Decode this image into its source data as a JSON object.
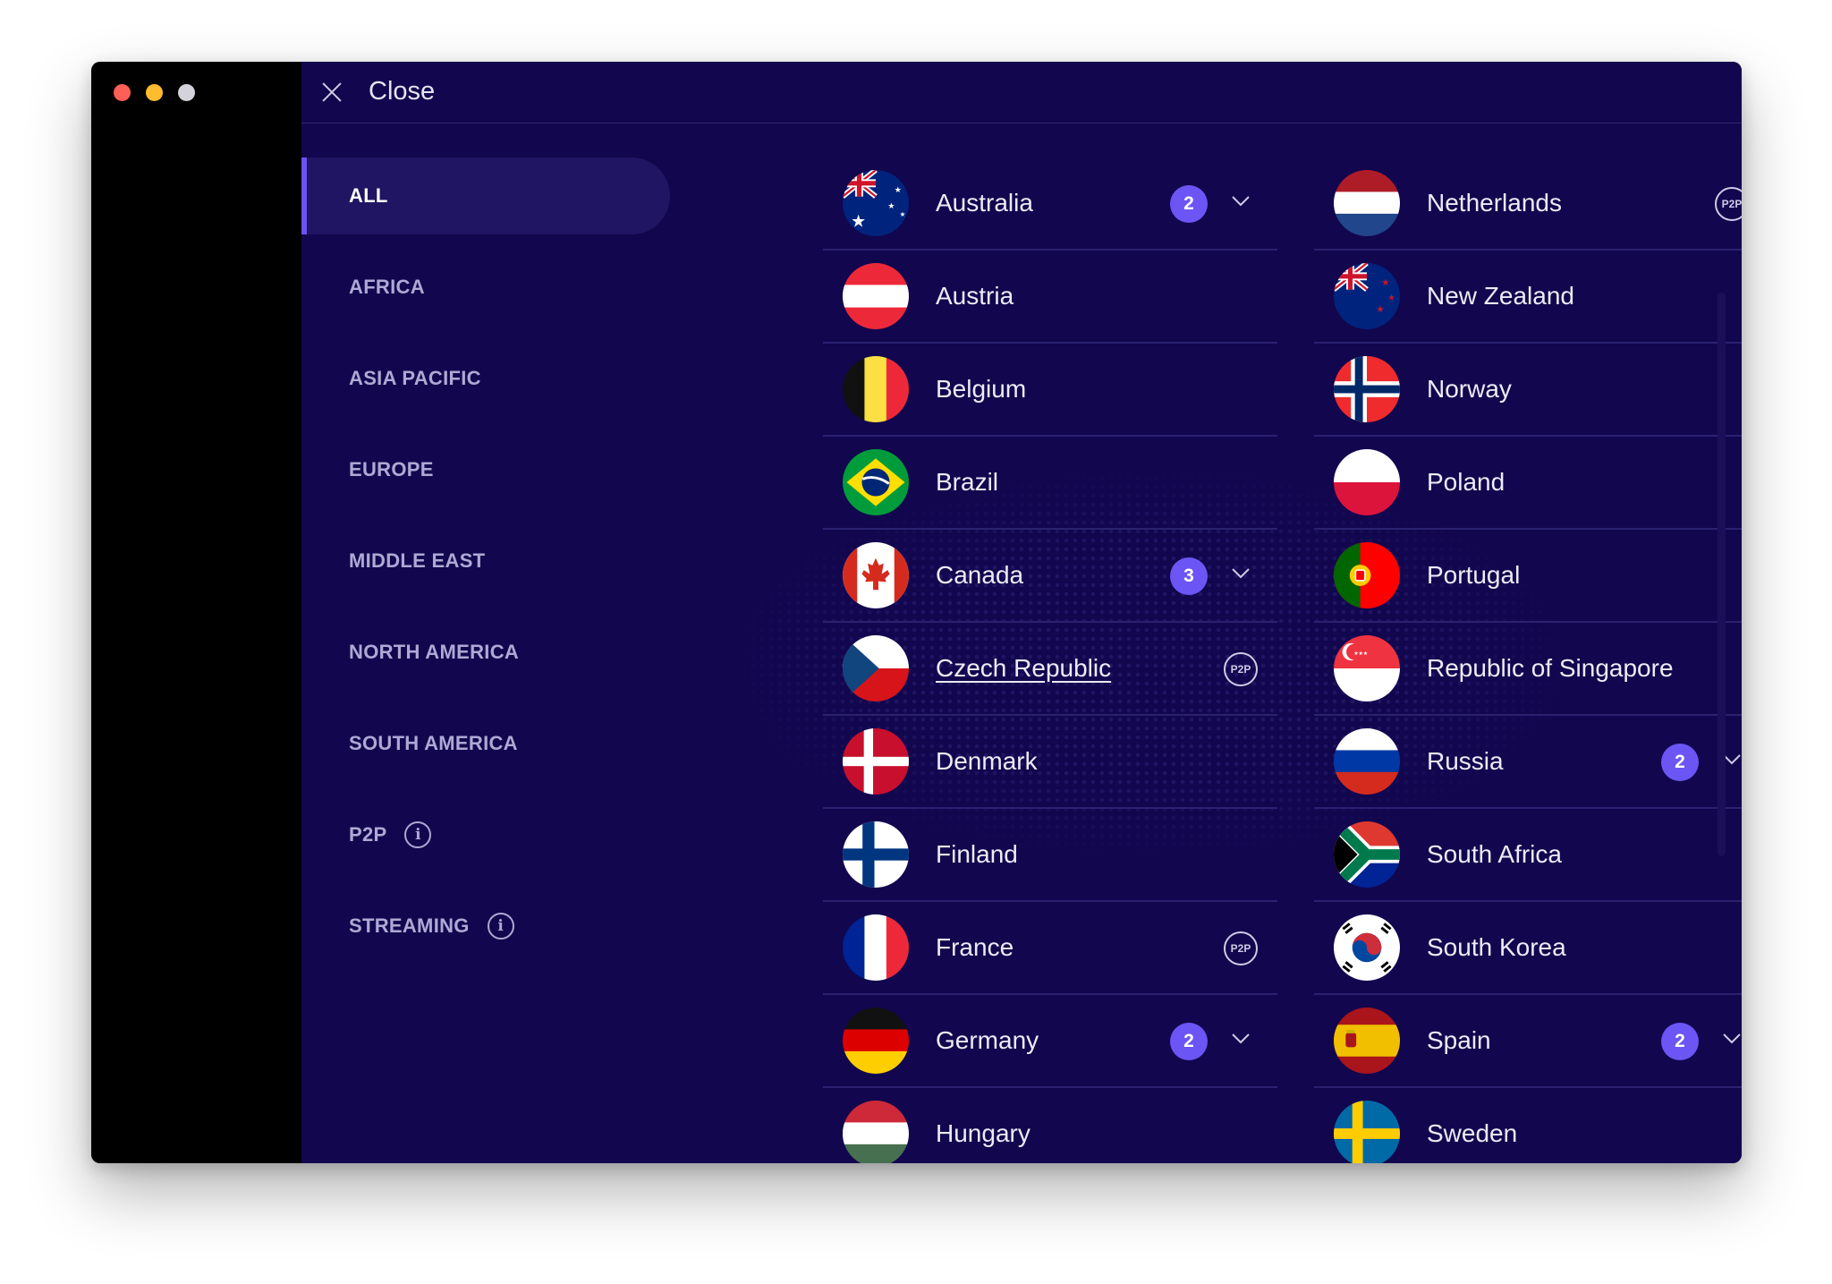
{
  "topbar": {
    "close_label": "Close"
  },
  "sidebar": {
    "categories": [
      {
        "label": "ALL",
        "active": true
      },
      {
        "label": "AFRICA"
      },
      {
        "label": "ASIA PACIFIC"
      },
      {
        "label": "EUROPE"
      },
      {
        "label": "MIDDLE EAST"
      },
      {
        "label": "NORTH AMERICA"
      },
      {
        "label": "SOUTH AMERICA"
      },
      {
        "label": "P2P",
        "info": true
      },
      {
        "label": "STREAMING",
        "info": true
      }
    ]
  },
  "countries": {
    "left": [
      {
        "name": "Australia",
        "count": "2",
        "flag": "australia-flag-icon"
      },
      {
        "name": "Austria",
        "flag": "austria-flag-icon"
      },
      {
        "name": "Belgium",
        "flag": "belgium-flag-icon"
      },
      {
        "name": "Brazil",
        "flag": "brazil-flag-icon"
      },
      {
        "name": "Canada",
        "count": "3",
        "flag": "canada-flag-icon"
      },
      {
        "name": "Czech Republic",
        "p2p": "P2P",
        "flag": "czech-flag-icon"
      },
      {
        "name": "Denmark",
        "flag": "denmark-flag-icon"
      },
      {
        "name": "Finland",
        "flag": "finland-flag-icon"
      },
      {
        "name": "France",
        "p2p": "P2P",
        "flag": "france-flag-icon"
      },
      {
        "name": "Germany",
        "count": "2",
        "flag": "germany-flag-icon"
      },
      {
        "name": "Hungary",
        "flag": "hungary-flag-icon"
      }
    ],
    "right": [
      {
        "name": "Netherlands",
        "p2p": "P2P",
        "flag": "netherlands-flag-icon"
      },
      {
        "name": "New Zealand",
        "flag": "new-zealand-flag-icon"
      },
      {
        "name": "Norway",
        "flag": "norway-flag-icon"
      },
      {
        "name": "Poland",
        "flag": "poland-flag-icon"
      },
      {
        "name": "Portugal",
        "flag": "portugal-flag-icon"
      },
      {
        "name": "Republic of Singapore",
        "flag": "singapore-flag-icon"
      },
      {
        "name": "Russia",
        "count": "2",
        "flag": "russia-flag-icon"
      },
      {
        "name": "South Africa",
        "flag": "south-africa-flag-icon"
      },
      {
        "name": "South Korea",
        "flag": "south-korea-flag-icon"
      },
      {
        "name": "Spain",
        "count": "2",
        "flag": "spain-flag-icon"
      },
      {
        "name": "Sweden",
        "flag": "sweden-flag-icon"
      }
    ]
  },
  "colors": {
    "background": "#12064e",
    "accent": "#6b55f4",
    "sidebar_active": "#201562"
  }
}
